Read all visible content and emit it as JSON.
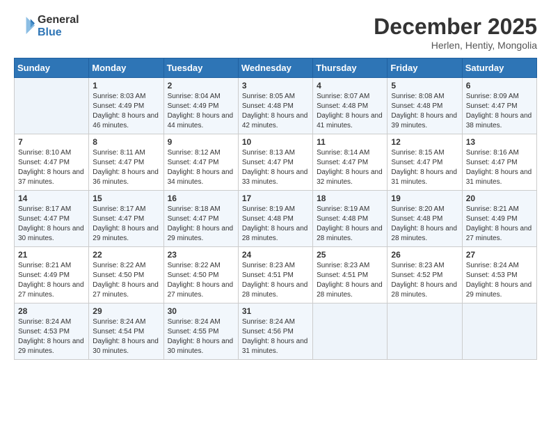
{
  "header": {
    "logo_line1": "General",
    "logo_line2": "Blue",
    "month": "December 2025",
    "location": "Herlen, Hentiy, Mongolia"
  },
  "weekdays": [
    "Sunday",
    "Monday",
    "Tuesday",
    "Wednesday",
    "Thursday",
    "Friday",
    "Saturday"
  ],
  "weeks": [
    [
      {
        "day": "",
        "empty": true
      },
      {
        "day": "1",
        "sunrise": "8:03 AM",
        "sunset": "4:49 PM",
        "daylight": "8 hours and 46 minutes."
      },
      {
        "day": "2",
        "sunrise": "8:04 AM",
        "sunset": "4:49 PM",
        "daylight": "8 hours and 44 minutes."
      },
      {
        "day": "3",
        "sunrise": "8:05 AM",
        "sunset": "4:48 PM",
        "daylight": "8 hours and 42 minutes."
      },
      {
        "day": "4",
        "sunrise": "8:07 AM",
        "sunset": "4:48 PM",
        "daylight": "8 hours and 41 minutes."
      },
      {
        "day": "5",
        "sunrise": "8:08 AM",
        "sunset": "4:48 PM",
        "daylight": "8 hours and 39 minutes."
      },
      {
        "day": "6",
        "sunrise": "8:09 AM",
        "sunset": "4:47 PM",
        "daylight": "8 hours and 38 minutes."
      }
    ],
    [
      {
        "day": "7",
        "sunrise": "8:10 AM",
        "sunset": "4:47 PM",
        "daylight": "8 hours and 37 minutes."
      },
      {
        "day": "8",
        "sunrise": "8:11 AM",
        "sunset": "4:47 PM",
        "daylight": "8 hours and 36 minutes."
      },
      {
        "day": "9",
        "sunrise": "8:12 AM",
        "sunset": "4:47 PM",
        "daylight": "8 hours and 34 minutes."
      },
      {
        "day": "10",
        "sunrise": "8:13 AM",
        "sunset": "4:47 PM",
        "daylight": "8 hours and 33 minutes."
      },
      {
        "day": "11",
        "sunrise": "8:14 AM",
        "sunset": "4:47 PM",
        "daylight": "8 hours and 32 minutes."
      },
      {
        "day": "12",
        "sunrise": "8:15 AM",
        "sunset": "4:47 PM",
        "daylight": "8 hours and 31 minutes."
      },
      {
        "day": "13",
        "sunrise": "8:16 AM",
        "sunset": "4:47 PM",
        "daylight": "8 hours and 31 minutes."
      }
    ],
    [
      {
        "day": "14",
        "sunrise": "8:17 AM",
        "sunset": "4:47 PM",
        "daylight": "8 hours and 30 minutes."
      },
      {
        "day": "15",
        "sunrise": "8:17 AM",
        "sunset": "4:47 PM",
        "daylight": "8 hours and 29 minutes."
      },
      {
        "day": "16",
        "sunrise": "8:18 AM",
        "sunset": "4:47 PM",
        "daylight": "8 hours and 29 minutes."
      },
      {
        "day": "17",
        "sunrise": "8:19 AM",
        "sunset": "4:48 PM",
        "daylight": "8 hours and 28 minutes."
      },
      {
        "day": "18",
        "sunrise": "8:19 AM",
        "sunset": "4:48 PM",
        "daylight": "8 hours and 28 minutes."
      },
      {
        "day": "19",
        "sunrise": "8:20 AM",
        "sunset": "4:48 PM",
        "daylight": "8 hours and 28 minutes."
      },
      {
        "day": "20",
        "sunrise": "8:21 AM",
        "sunset": "4:49 PM",
        "daylight": "8 hours and 27 minutes."
      }
    ],
    [
      {
        "day": "21",
        "sunrise": "8:21 AM",
        "sunset": "4:49 PM",
        "daylight": "8 hours and 27 minutes."
      },
      {
        "day": "22",
        "sunrise": "8:22 AM",
        "sunset": "4:50 PM",
        "daylight": "8 hours and 27 minutes."
      },
      {
        "day": "23",
        "sunrise": "8:22 AM",
        "sunset": "4:50 PM",
        "daylight": "8 hours and 27 minutes."
      },
      {
        "day": "24",
        "sunrise": "8:23 AM",
        "sunset": "4:51 PM",
        "daylight": "8 hours and 28 minutes."
      },
      {
        "day": "25",
        "sunrise": "8:23 AM",
        "sunset": "4:51 PM",
        "daylight": "8 hours and 28 minutes."
      },
      {
        "day": "26",
        "sunrise": "8:23 AM",
        "sunset": "4:52 PM",
        "daylight": "8 hours and 28 minutes."
      },
      {
        "day": "27",
        "sunrise": "8:24 AM",
        "sunset": "4:53 PM",
        "daylight": "8 hours and 29 minutes."
      }
    ],
    [
      {
        "day": "28",
        "sunrise": "8:24 AM",
        "sunset": "4:53 PM",
        "daylight": "8 hours and 29 minutes."
      },
      {
        "day": "29",
        "sunrise": "8:24 AM",
        "sunset": "4:54 PM",
        "daylight": "8 hours and 30 minutes."
      },
      {
        "day": "30",
        "sunrise": "8:24 AM",
        "sunset": "4:55 PM",
        "daylight": "8 hours and 30 minutes."
      },
      {
        "day": "31",
        "sunrise": "8:24 AM",
        "sunset": "4:56 PM",
        "daylight": "8 hours and 31 minutes."
      },
      {
        "day": "",
        "empty": true
      },
      {
        "day": "",
        "empty": true
      },
      {
        "day": "",
        "empty": true
      }
    ]
  ],
  "labels": {
    "sunrise_prefix": "Sunrise: ",
    "sunset_prefix": "Sunset: ",
    "daylight_label": "Daylight hours"
  }
}
